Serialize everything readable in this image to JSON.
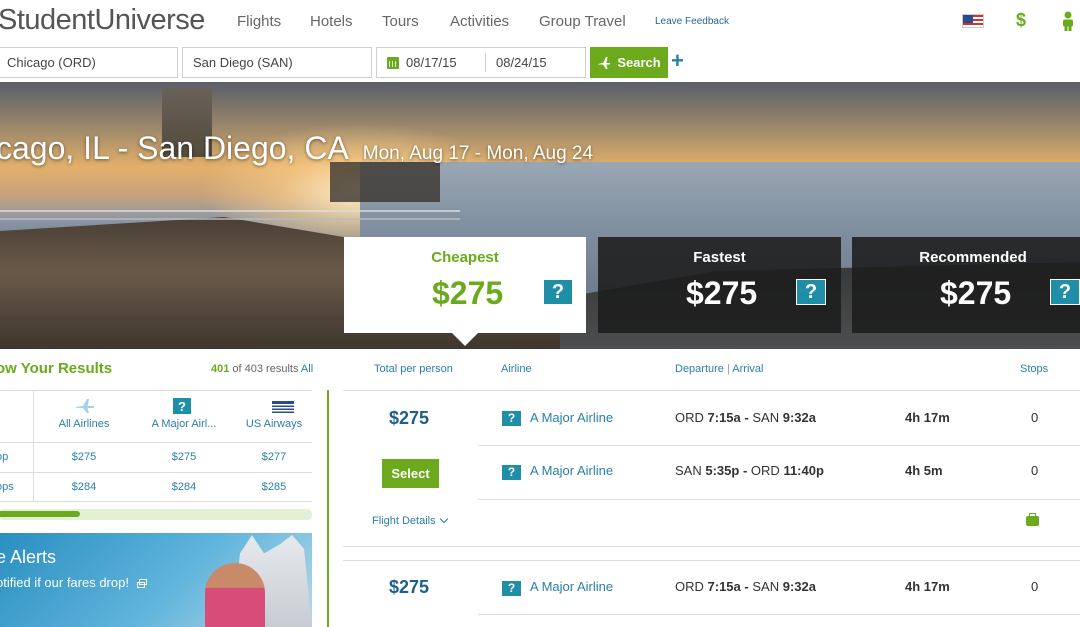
{
  "brand": {
    "logo": "StudentUniverse"
  },
  "nav": {
    "items": [
      "Flights",
      "Hotels",
      "Tours",
      "Activities",
      "Group Travel"
    ],
    "feedback": "Leave Feedback",
    "currency_symbol": "$"
  },
  "search": {
    "from": "Chicago (ORD)",
    "to": "San Diego (SAN)",
    "depart_date": "08/17/15",
    "return_date": "08/24/15",
    "search_label": "Search",
    "add_symbol": "+"
  },
  "hero": {
    "route": "cago, IL - San Diego, CA",
    "dates": "Mon, Aug 17 - Mon, Aug 24"
  },
  "sort_cards": [
    {
      "label": "Cheapest",
      "price": "$275",
      "help": "?"
    },
    {
      "label": "Fastest",
      "price": "$275",
      "help": "?"
    },
    {
      "label": "Recommended",
      "price": "$275",
      "help": "?"
    }
  ],
  "narrow": {
    "title": "ow Your Results",
    "count": "401",
    "of_text": "of 403 results",
    "all": "All"
  },
  "matrix": {
    "columns": [
      {
        "label": "All Airlines",
        "icon": "plane-icon"
      },
      {
        "label": "A Major Airl...",
        "icon": "help-icon",
        "help": "?"
      },
      {
        "label": "US Airways",
        "icon": "us-airways-logo-icon"
      }
    ],
    "rows": [
      {
        "label": "op",
        "values": [
          "$275",
          "$275",
          "$277"
        ]
      },
      {
        "label": "ops",
        "values": [
          "$284",
          "$284",
          "$285"
        ]
      }
    ]
  },
  "alerts": {
    "title": "e Alerts",
    "subtitle": "otified if our fares drop!"
  },
  "results_header": {
    "total": "Total per person",
    "airline": "Airline",
    "departure": "Departure",
    "separator": "|",
    "arrival": "Arrival",
    "stops": "Stops"
  },
  "results": [
    {
      "price": "$275",
      "select_label": "Select",
      "details_label": "Flight Details",
      "legs": [
        {
          "help": "?",
          "airline": "A Major Airline",
          "from": "ORD",
          "dep": "7:15a",
          "dash": "-",
          "to": "SAN",
          "arr": "9:32a",
          "duration": "4h 17m",
          "stops": "0"
        },
        {
          "help": "?",
          "airline": "A Major Airline",
          "from": "SAN",
          "dep": "5:35p",
          "dash": "-",
          "to": "ORD",
          "arr": "11:40p",
          "duration": "4h 5m",
          "stops": "0"
        }
      ]
    },
    {
      "price": "$275",
      "legs": [
        {
          "help": "?",
          "airline": "A Major Airline",
          "from": "ORD",
          "dep": "7:15a",
          "dash": "-",
          "to": "SAN",
          "arr": "9:32a",
          "duration": "4h 17m",
          "stops": "0"
        }
      ]
    }
  ],
  "colors": {
    "brand_green": "#6aaa1c",
    "link_blue": "#2a7fa8",
    "price_blue": "#1d5f8a",
    "help_teal": "#1f8fa7"
  }
}
